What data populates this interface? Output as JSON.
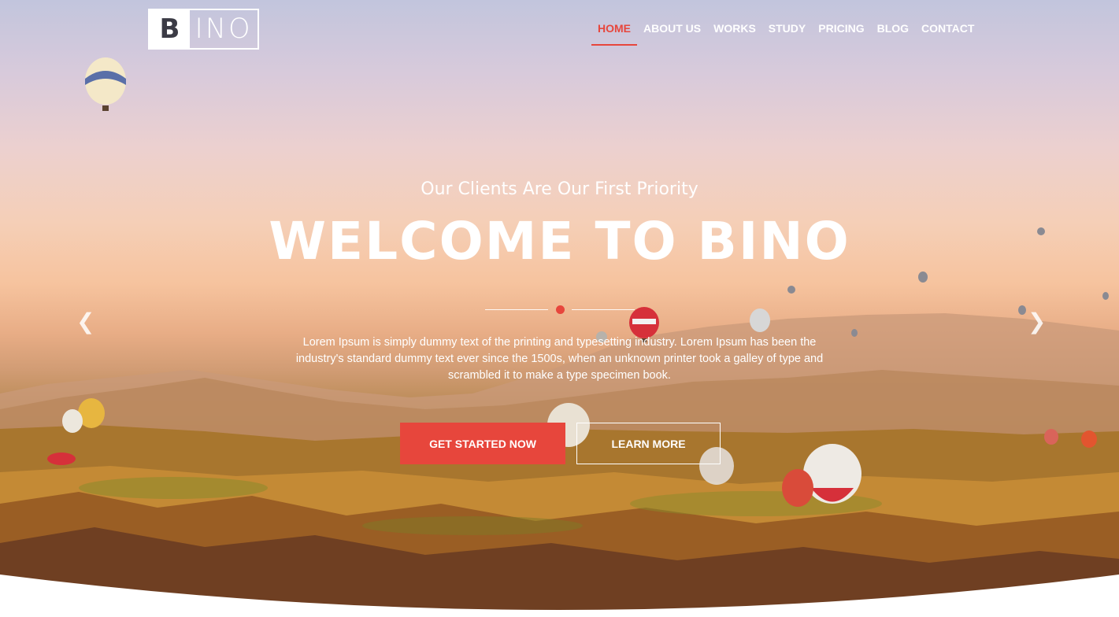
{
  "brand": {
    "logo_letter": "B",
    "logo_rest": "INO",
    "accent_color": "#e7463c"
  },
  "nav": {
    "items": [
      {
        "label": "HOME",
        "active": true
      },
      {
        "label": "ABOUT US",
        "active": false
      },
      {
        "label": "WORKS",
        "active": false
      },
      {
        "label": "STUDY",
        "active": false
      },
      {
        "label": "PRICING",
        "active": false
      },
      {
        "label": "BLOG",
        "active": false
      },
      {
        "label": "CONTACT",
        "active": false
      }
    ]
  },
  "hero": {
    "tagline": "Our Clients Are Our First Priority",
    "headline": "WELCOME TO BINO",
    "lead": "Lorem Ipsum is simply dummy text of the printing and typesetting industry. Lorem Ipsum has been the industry's standard dummy text ever since the 1500s, when an unknown printer took a galley of type and scrambled it to make a type specimen book.",
    "primary_cta": "GET STARTED NOW",
    "secondary_cta": "LEARN MORE",
    "prev_icon": "chevron-left-icon",
    "next_icon": "chevron-right-icon",
    "background": "hot-air-balloons-landscape"
  }
}
